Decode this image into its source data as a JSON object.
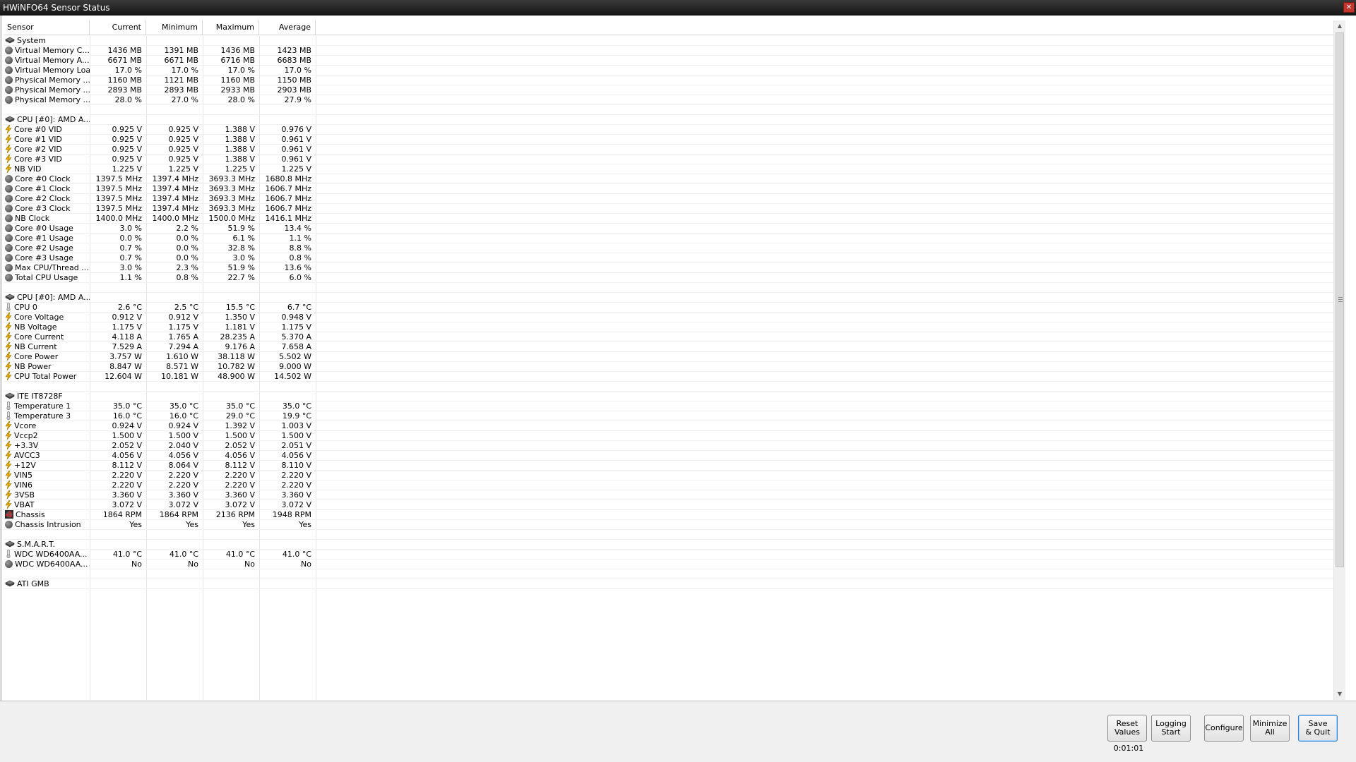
{
  "window": {
    "title": "HWiNFO64 Sensor Status",
    "close_glyph": "✕"
  },
  "columns": {
    "sensor": "Sensor",
    "current": "Current",
    "minimum": "Minimum",
    "maximum": "Maximum",
    "average": "Average"
  },
  "rows": [
    {
      "type": "group",
      "icon": "chip-icon",
      "name": "System"
    },
    {
      "icon": "circle-icon",
      "name": "Virtual Memory C...",
      "cur": "1436 MB",
      "min": "1391 MB",
      "max": "1436 MB",
      "avg": "1423 MB"
    },
    {
      "icon": "circle-icon",
      "name": "Virtual Memory A...",
      "cur": "6671 MB",
      "min": "6671 MB",
      "max": "6716 MB",
      "avg": "6683 MB"
    },
    {
      "icon": "circle-icon",
      "name": "Virtual Memory Load",
      "cur": "17.0 %",
      "min": "17.0 %",
      "max": "17.0 %",
      "avg": "17.0 %"
    },
    {
      "icon": "circle-icon",
      "name": "Physical Memory ...",
      "cur": "1160 MB",
      "min": "1121 MB",
      "max": "1160 MB",
      "avg": "1150 MB"
    },
    {
      "icon": "circle-icon",
      "name": "Physical Memory ...",
      "cur": "2893 MB",
      "min": "2893 MB",
      "max": "2933 MB",
      "avg": "2903 MB"
    },
    {
      "icon": "circle-icon",
      "name": "Physical Memory ...",
      "cur": "28.0 %",
      "min": "27.0 %",
      "max": "28.0 %",
      "avg": "27.9 %"
    },
    {
      "type": "empty"
    },
    {
      "type": "group",
      "icon": "chip-icon",
      "name": "CPU [#0]: AMD A..."
    },
    {
      "icon": "bolt-icon",
      "name": "Core #0 VID",
      "cur": "0.925 V",
      "min": "0.925 V",
      "max": "1.388 V",
      "avg": "0.976 V"
    },
    {
      "icon": "bolt-icon",
      "name": "Core #1 VID",
      "cur": "0.925 V",
      "min": "0.925 V",
      "max": "1.388 V",
      "avg": "0.961 V"
    },
    {
      "icon": "bolt-icon",
      "name": "Core #2 VID",
      "cur": "0.925 V",
      "min": "0.925 V",
      "max": "1.388 V",
      "avg": "0.961 V"
    },
    {
      "icon": "bolt-icon",
      "name": "Core #3 VID",
      "cur": "0.925 V",
      "min": "0.925 V",
      "max": "1.388 V",
      "avg": "0.961 V"
    },
    {
      "icon": "bolt-icon",
      "name": "NB VID",
      "cur": "1.225 V",
      "min": "1.225 V",
      "max": "1.225 V",
      "avg": "1.225 V"
    },
    {
      "icon": "circle-icon",
      "name": "Core #0 Clock",
      "cur": "1397.5 MHz",
      "min": "1397.4 MHz",
      "max": "3693.3 MHz",
      "avg": "1680.8 MHz"
    },
    {
      "icon": "circle-icon",
      "name": "Core #1 Clock",
      "cur": "1397.5 MHz",
      "min": "1397.4 MHz",
      "max": "3693.3 MHz",
      "avg": "1606.7 MHz"
    },
    {
      "icon": "circle-icon",
      "name": "Core #2 Clock",
      "cur": "1397.5 MHz",
      "min": "1397.4 MHz",
      "max": "3693.3 MHz",
      "avg": "1606.7 MHz"
    },
    {
      "icon": "circle-icon",
      "name": "Core #3 Clock",
      "cur": "1397.5 MHz",
      "min": "1397.4 MHz",
      "max": "3693.3 MHz",
      "avg": "1606.7 MHz"
    },
    {
      "icon": "circle-icon",
      "name": "NB Clock",
      "cur": "1400.0 MHz",
      "min": "1400.0 MHz",
      "max": "1500.0 MHz",
      "avg": "1416.1 MHz"
    },
    {
      "icon": "circle-icon",
      "name": "Core #0 Usage",
      "cur": "3.0 %",
      "min": "2.2 %",
      "max": "51.9 %",
      "avg": "13.4 %"
    },
    {
      "icon": "circle-icon",
      "name": "Core #1 Usage",
      "cur": "0.0 %",
      "min": "0.0 %",
      "max": "6.1 %",
      "avg": "1.1 %"
    },
    {
      "icon": "circle-icon",
      "name": "Core #2 Usage",
      "cur": "0.7 %",
      "min": "0.0 %",
      "max": "32.8 %",
      "avg": "8.8 %"
    },
    {
      "icon": "circle-icon",
      "name": "Core #3 Usage",
      "cur": "0.7 %",
      "min": "0.0 %",
      "max": "3.0 %",
      "avg": "0.8 %"
    },
    {
      "icon": "circle-icon",
      "name": "Max CPU/Thread ...",
      "cur": "3.0 %",
      "min": "2.3 %",
      "max": "51.9 %",
      "avg": "13.6 %"
    },
    {
      "icon": "circle-icon",
      "name": "Total CPU Usage",
      "cur": "1.1 %",
      "min": "0.8 %",
      "max": "22.7 %",
      "avg": "6.0 %"
    },
    {
      "type": "empty"
    },
    {
      "type": "group",
      "icon": "chip-icon",
      "name": "CPU [#0]: AMD A..."
    },
    {
      "icon": "thermometer-icon",
      "name": "CPU 0",
      "cur": "2.6 °C",
      "min": "2.5 °C",
      "max": "15.5 °C",
      "avg": "6.7 °C"
    },
    {
      "icon": "bolt-icon",
      "name": "Core Voltage",
      "cur": "0.912 V",
      "min": "0.912 V",
      "max": "1.350 V",
      "avg": "0.948 V"
    },
    {
      "icon": "bolt-icon",
      "name": "NB Voltage",
      "cur": "1.175 V",
      "min": "1.175 V",
      "max": "1.181 V",
      "avg": "1.175 V"
    },
    {
      "icon": "bolt-icon",
      "name": "Core Current",
      "cur": "4.118 A",
      "min": "1.765 A",
      "max": "28.235 A",
      "avg": "5.370 A"
    },
    {
      "icon": "bolt-icon",
      "name": "NB Current",
      "cur": "7.529 A",
      "min": "7.294 A",
      "max": "9.176 A",
      "avg": "7.658 A"
    },
    {
      "icon": "bolt-icon",
      "name": "Core Power",
      "cur": "3.757 W",
      "min": "1.610 W",
      "max": "38.118 W",
      "avg": "5.502 W"
    },
    {
      "icon": "bolt-icon",
      "name": "NB Power",
      "cur": "8.847 W",
      "min": "8.571 W",
      "max": "10.782 W",
      "avg": "9.000 W"
    },
    {
      "icon": "bolt-icon",
      "name": "CPU Total Power",
      "cur": "12.604 W",
      "min": "10.181 W",
      "max": "48.900 W",
      "avg": "14.502 W"
    },
    {
      "type": "empty"
    },
    {
      "type": "group",
      "icon": "chip-icon",
      "name": "ITE IT8728F"
    },
    {
      "icon": "thermometer-icon",
      "name": "Temperature 1",
      "cur": "35.0 °C",
      "min": "35.0 °C",
      "max": "35.0 °C",
      "avg": "35.0 °C"
    },
    {
      "icon": "thermometer-icon",
      "name": "Temperature 3",
      "cur": "16.0 °C",
      "min": "16.0 °C",
      "max": "29.0 °C",
      "avg": "19.9 °C"
    },
    {
      "icon": "bolt-icon",
      "name": "Vcore",
      "cur": "0.924 V",
      "min": "0.924 V",
      "max": "1.392 V",
      "avg": "1.003 V"
    },
    {
      "icon": "bolt-icon",
      "name": "Vccp2",
      "cur": "1.500 V",
      "min": "1.500 V",
      "max": "1.500 V",
      "avg": "1.500 V"
    },
    {
      "icon": "bolt-icon",
      "name": "+3.3V",
      "cur": "2.052 V",
      "min": "2.040 V",
      "max": "2.052 V",
      "avg": "2.051 V"
    },
    {
      "icon": "bolt-icon",
      "name": "AVCC3",
      "cur": "4.056 V",
      "min": "4.056 V",
      "max": "4.056 V",
      "avg": "4.056 V"
    },
    {
      "icon": "bolt-icon",
      "name": "+12V",
      "cur": "8.112 V",
      "min": "8.064 V",
      "max": "8.112 V",
      "avg": "8.110 V"
    },
    {
      "icon": "bolt-icon",
      "name": "VIN5",
      "cur": "2.220 V",
      "min": "2.220 V",
      "max": "2.220 V",
      "avg": "2.220 V"
    },
    {
      "icon": "bolt-icon",
      "name": "VIN6",
      "cur": "2.220 V",
      "min": "2.220 V",
      "max": "2.220 V",
      "avg": "2.220 V"
    },
    {
      "icon": "bolt-icon",
      "name": "3VSB",
      "cur": "3.360 V",
      "min": "3.360 V",
      "max": "3.360 V",
      "avg": "3.360 V"
    },
    {
      "icon": "bolt-icon",
      "name": "VBAT",
      "cur": "3.072 V",
      "min": "3.072 V",
      "max": "3.072 V",
      "avg": "3.072 V"
    },
    {
      "icon": "fan-icon",
      "name": "Chassis",
      "cur": "1864 RPM",
      "min": "1864 RPM",
      "max": "2136 RPM",
      "avg": "1948 RPM"
    },
    {
      "icon": "circle-icon",
      "name": "Chassis Intrusion",
      "cur": "Yes",
      "min": "Yes",
      "max": "Yes",
      "avg": "Yes"
    },
    {
      "type": "empty"
    },
    {
      "type": "group",
      "icon": "chip-icon",
      "name": "S.M.A.R.T."
    },
    {
      "icon": "thermometer-icon",
      "name": "WDC WD6400AA...",
      "cur": "41.0 °C",
      "min": "41.0 °C",
      "max": "41.0 °C",
      "avg": "41.0 °C"
    },
    {
      "icon": "circle-icon",
      "name": "WDC WD6400AA...",
      "cur": "No",
      "min": "No",
      "max": "No",
      "avg": "No"
    },
    {
      "type": "empty"
    },
    {
      "type": "group",
      "icon": "chip-icon",
      "name": "ATI GMB"
    }
  ],
  "buttons": [
    {
      "name": "reset-values-button",
      "line1": "Reset",
      "line2": "Values"
    },
    {
      "name": "logging-start-button",
      "line1": "Logging",
      "line2": "Start"
    },
    {
      "name": "configure-button",
      "line1": "Configure",
      "line2": ""
    },
    {
      "name": "minimize-all-button",
      "line1": "Minimize",
      "line2": "All"
    },
    {
      "name": "save-quit-button",
      "line1": "Save",
      "line2": "& Quit"
    }
  ],
  "timer": "0:01:01",
  "colors": {
    "bolt": "#e0a800",
    "thermometer": "#8a8a8a",
    "chip": "#555555",
    "fan": "#303030",
    "primary_button_border": "#2f7fd1"
  }
}
